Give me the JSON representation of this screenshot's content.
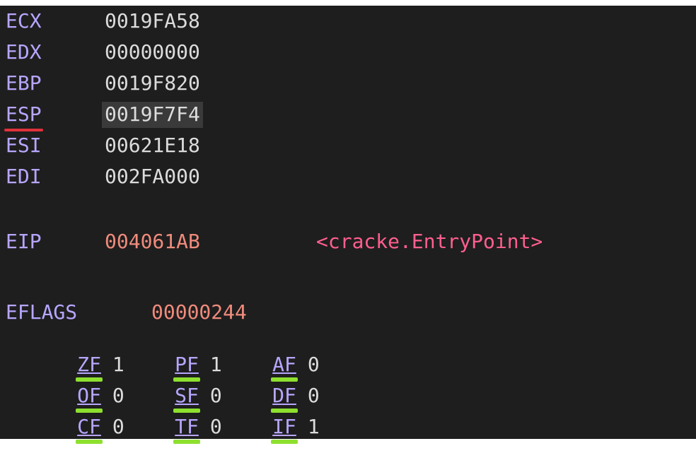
{
  "registers": [
    {
      "name": "ECX",
      "value": "0019FA58"
    },
    {
      "name": "EDX",
      "value": "00000000"
    },
    {
      "name": "EBP",
      "value": "0019F820"
    },
    {
      "name": "ESP",
      "value": "0019F7F4"
    },
    {
      "name": "ESI",
      "value": "00621E18"
    },
    {
      "name": "EDI",
      "value": "002FA000"
    }
  ],
  "eip": {
    "name": "EIP",
    "value": "004061AB",
    "comment": "<cracke.EntryPoint>"
  },
  "eflags": {
    "name": "EFLAGS",
    "value": "00000244"
  },
  "flags": [
    [
      {
        "name": "ZF",
        "value": "1"
      },
      {
        "name": "PF",
        "value": "1"
      },
      {
        "name": "AF",
        "value": "0"
      }
    ],
    [
      {
        "name": "OF",
        "value": "0"
      },
      {
        "name": "SF",
        "value": "0"
      },
      {
        "name": "DF",
        "value": "0"
      }
    ],
    [
      {
        "name": "CF",
        "value": "0"
      },
      {
        "name": "TF",
        "value": "0"
      },
      {
        "name": "IF",
        "value": "1"
      }
    ]
  ],
  "colors": {
    "background": "#1e1e1e",
    "register_name": "#b8a6ff",
    "value_text": "#dcdcdc",
    "changed_value": "#f08b7c",
    "comment": "#ff5f8f",
    "esp_underline": "#e0313b",
    "flag_underline": "#8ee02f",
    "highlight": "#3a3a3a"
  }
}
